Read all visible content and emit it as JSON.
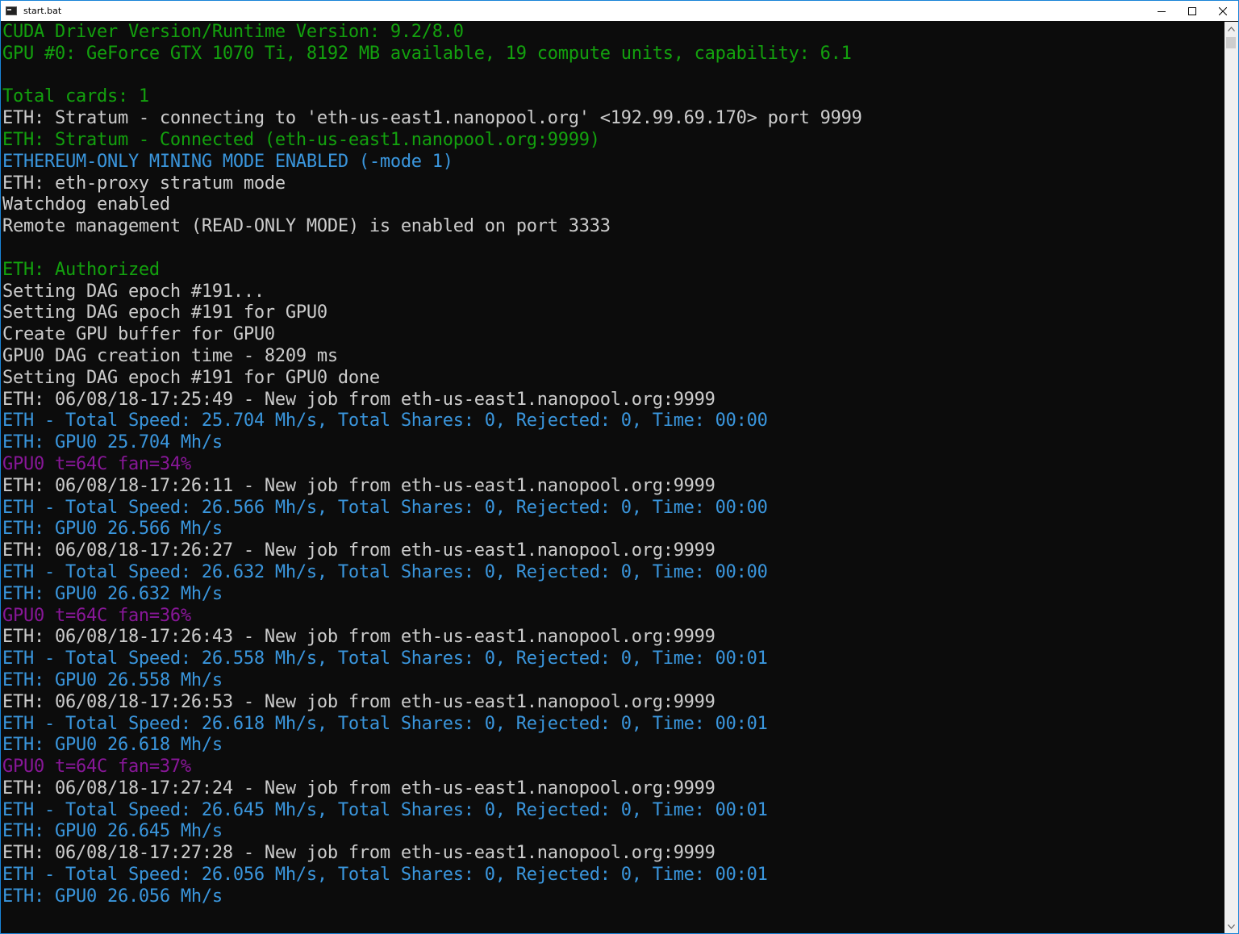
{
  "window": {
    "title": "start.bat",
    "app_icon": "cmd-icon",
    "controls": [
      "minimize-icon",
      "maximize-icon",
      "close-icon"
    ]
  },
  "colors": {
    "white": "#cccccc",
    "green": "#13a10e",
    "blue": "#3a96dd",
    "magenta": "#881798",
    "background": "#0c0c0c"
  },
  "console": {
    "lines": [
      {
        "text": "CUDA Driver Version/Runtime Version: 9.2/8.0",
        "color": "green"
      },
      {
        "text": "GPU #0: GeForce GTX 1070 Ti, 8192 MB available, 19 compute units, capability: 6.1",
        "color": "green"
      },
      {
        "text": "",
        "color": "white"
      },
      {
        "text": "Total cards: 1",
        "color": "green"
      },
      {
        "text": "ETH: Stratum - connecting to 'eth-us-east1.nanopool.org' <192.99.69.170> port 9999",
        "color": "white"
      },
      {
        "text": "ETH: Stratum - Connected (eth-us-east1.nanopool.org:9999)",
        "color": "green"
      },
      {
        "text": "ETHEREUM-ONLY MINING MODE ENABLED (-mode 1)",
        "color": "blue"
      },
      {
        "text": "ETH: eth-proxy stratum mode",
        "color": "white"
      },
      {
        "text": "Watchdog enabled",
        "color": "white"
      },
      {
        "text": "Remote management (READ-ONLY MODE) is enabled on port 3333",
        "color": "white"
      },
      {
        "text": "",
        "color": "white"
      },
      {
        "text": "ETH: Authorized",
        "color": "green"
      },
      {
        "text": "Setting DAG epoch #191...",
        "color": "white"
      },
      {
        "text": "Setting DAG epoch #191 for GPU0",
        "color": "white"
      },
      {
        "text": "Create GPU buffer for GPU0",
        "color": "white"
      },
      {
        "text": "GPU0 DAG creation time - 8209 ms",
        "color": "white"
      },
      {
        "text": "Setting DAG epoch #191 for GPU0 done",
        "color": "white"
      },
      {
        "text": "ETH: 06/08/18-17:25:49 - New job from eth-us-east1.nanopool.org:9999",
        "color": "white"
      },
      {
        "text": "ETH - Total Speed: 25.704 Mh/s, Total Shares: 0, Rejected: 0, Time: 00:00",
        "color": "blue"
      },
      {
        "text": "ETH: GPU0 25.704 Mh/s",
        "color": "blue"
      },
      {
        "text": "GPU0 t=64C fan=34%",
        "color": "magenta"
      },
      {
        "text": "ETH: 06/08/18-17:26:11 - New job from eth-us-east1.nanopool.org:9999",
        "color": "white"
      },
      {
        "text": "ETH - Total Speed: 26.566 Mh/s, Total Shares: 0, Rejected: 0, Time: 00:00",
        "color": "blue"
      },
      {
        "text": "ETH: GPU0 26.566 Mh/s",
        "color": "blue"
      },
      {
        "text": "ETH: 06/08/18-17:26:27 - New job from eth-us-east1.nanopool.org:9999",
        "color": "white"
      },
      {
        "text": "ETH - Total Speed: 26.632 Mh/s, Total Shares: 0, Rejected: 0, Time: 00:00",
        "color": "blue"
      },
      {
        "text": "ETH: GPU0 26.632 Mh/s",
        "color": "blue"
      },
      {
        "text": "GPU0 t=64C fan=36%",
        "color": "magenta"
      },
      {
        "text": "ETH: 06/08/18-17:26:43 - New job from eth-us-east1.nanopool.org:9999",
        "color": "white"
      },
      {
        "text": "ETH - Total Speed: 26.558 Mh/s, Total Shares: 0, Rejected: 0, Time: 00:01",
        "color": "blue"
      },
      {
        "text": "ETH: GPU0 26.558 Mh/s",
        "color": "blue"
      },
      {
        "text": "ETH: 06/08/18-17:26:53 - New job from eth-us-east1.nanopool.org:9999",
        "color": "white"
      },
      {
        "text": "ETH - Total Speed: 26.618 Mh/s, Total Shares: 0, Rejected: 0, Time: 00:01",
        "color": "blue"
      },
      {
        "text": "ETH: GPU0 26.618 Mh/s",
        "color": "blue"
      },
      {
        "text": "GPU0 t=64C fan=37%",
        "color": "magenta"
      },
      {
        "text": "ETH: 06/08/18-17:27:24 - New job from eth-us-east1.nanopool.org:9999",
        "color": "white"
      },
      {
        "text": "ETH - Total Speed: 26.645 Mh/s, Total Shares: 0, Rejected: 0, Time: 00:01",
        "color": "blue"
      },
      {
        "text": "ETH: GPU0 26.645 Mh/s",
        "color": "blue"
      },
      {
        "text": "ETH: 06/08/18-17:27:28 - New job from eth-us-east1.nanopool.org:9999",
        "color": "white"
      },
      {
        "text": "ETH - Total Speed: 26.056 Mh/s, Total Shares: 0, Rejected: 0, Time: 00:01",
        "color": "blue"
      },
      {
        "text": "ETH: GPU0 26.056 Mh/s",
        "color": "blue"
      }
    ]
  }
}
